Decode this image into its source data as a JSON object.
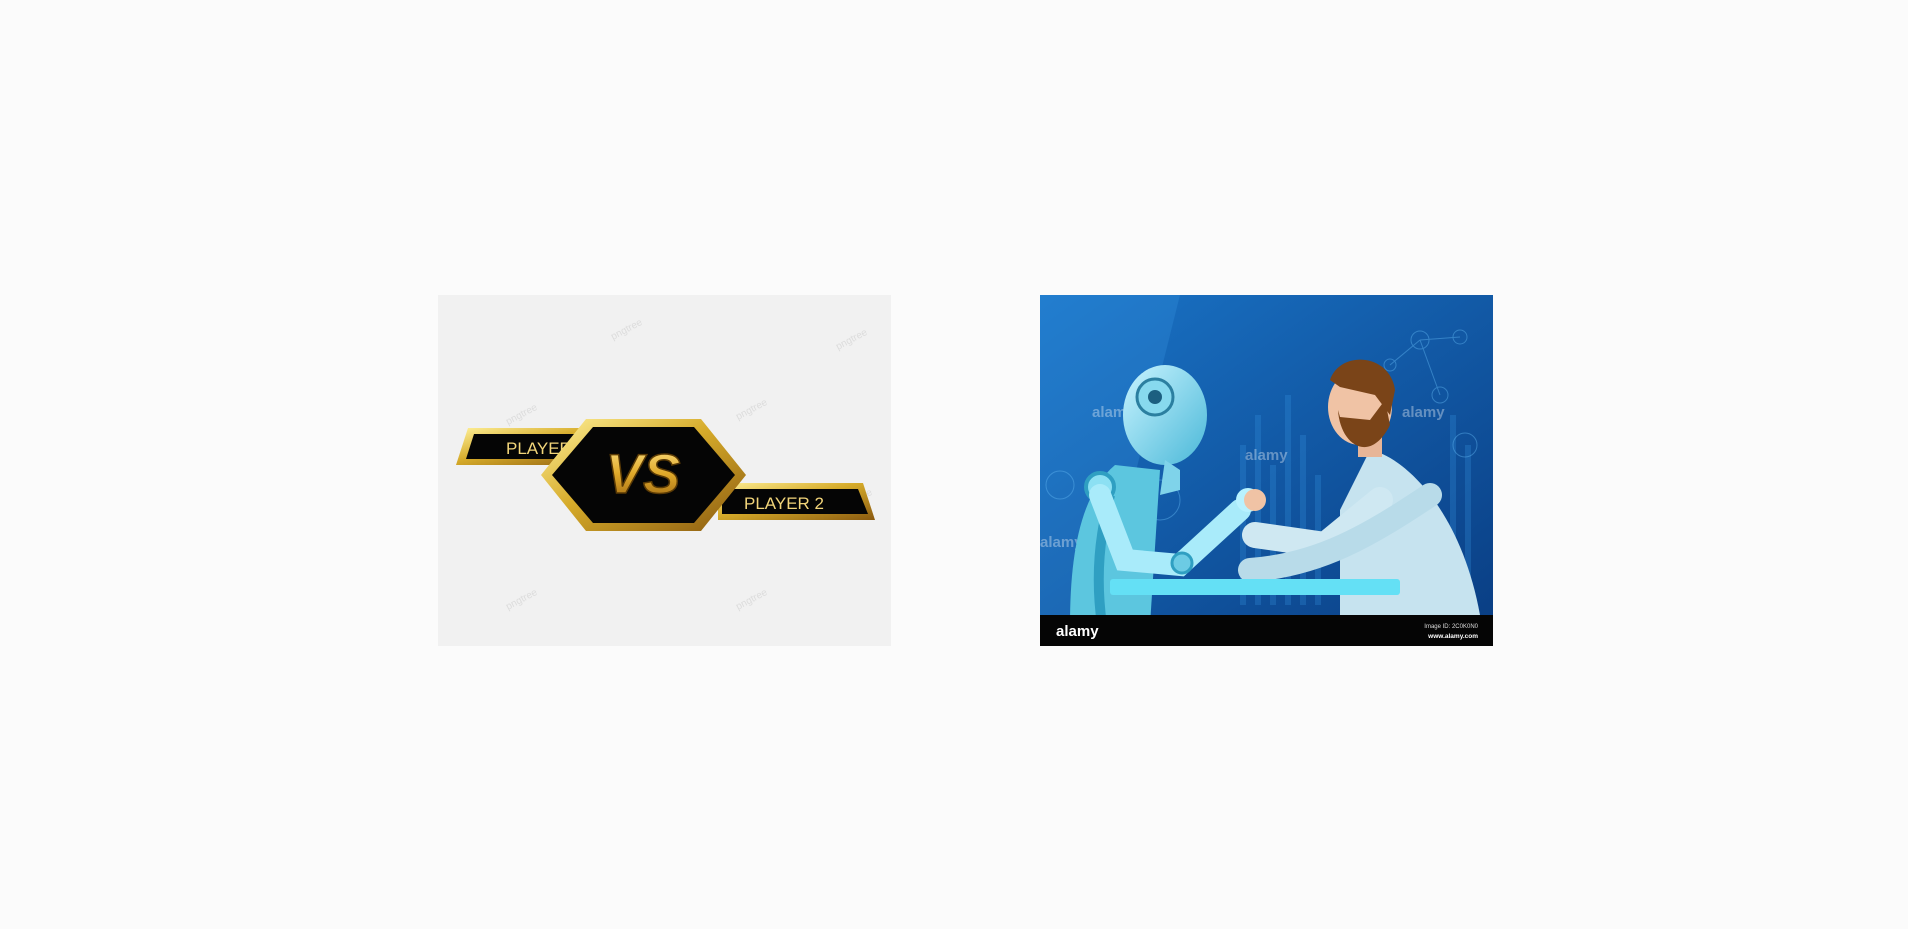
{
  "images": [
    {
      "kind": "vs-banner",
      "player1_label": "PLAYER 1",
      "vs_label": "VS",
      "player2_label": "PLAYER 2",
      "watermark": "pngtree",
      "colors": {
        "background": "#f1f1f1",
        "gold": "#d6ab2a",
        "black": "#050505"
      }
    },
    {
      "kind": "robot-vs-human-arm-wrestling",
      "watermark": "alamy",
      "footer": {
        "brand": "alamy",
        "image_id": "Image ID: 2C0K0N0",
        "url": "www.alamy.com"
      },
      "colors": {
        "background": "#0d4f9c",
        "robot": "#9fe4f5",
        "shirt": "#c6e3ef",
        "footer": "#050505"
      }
    }
  ]
}
